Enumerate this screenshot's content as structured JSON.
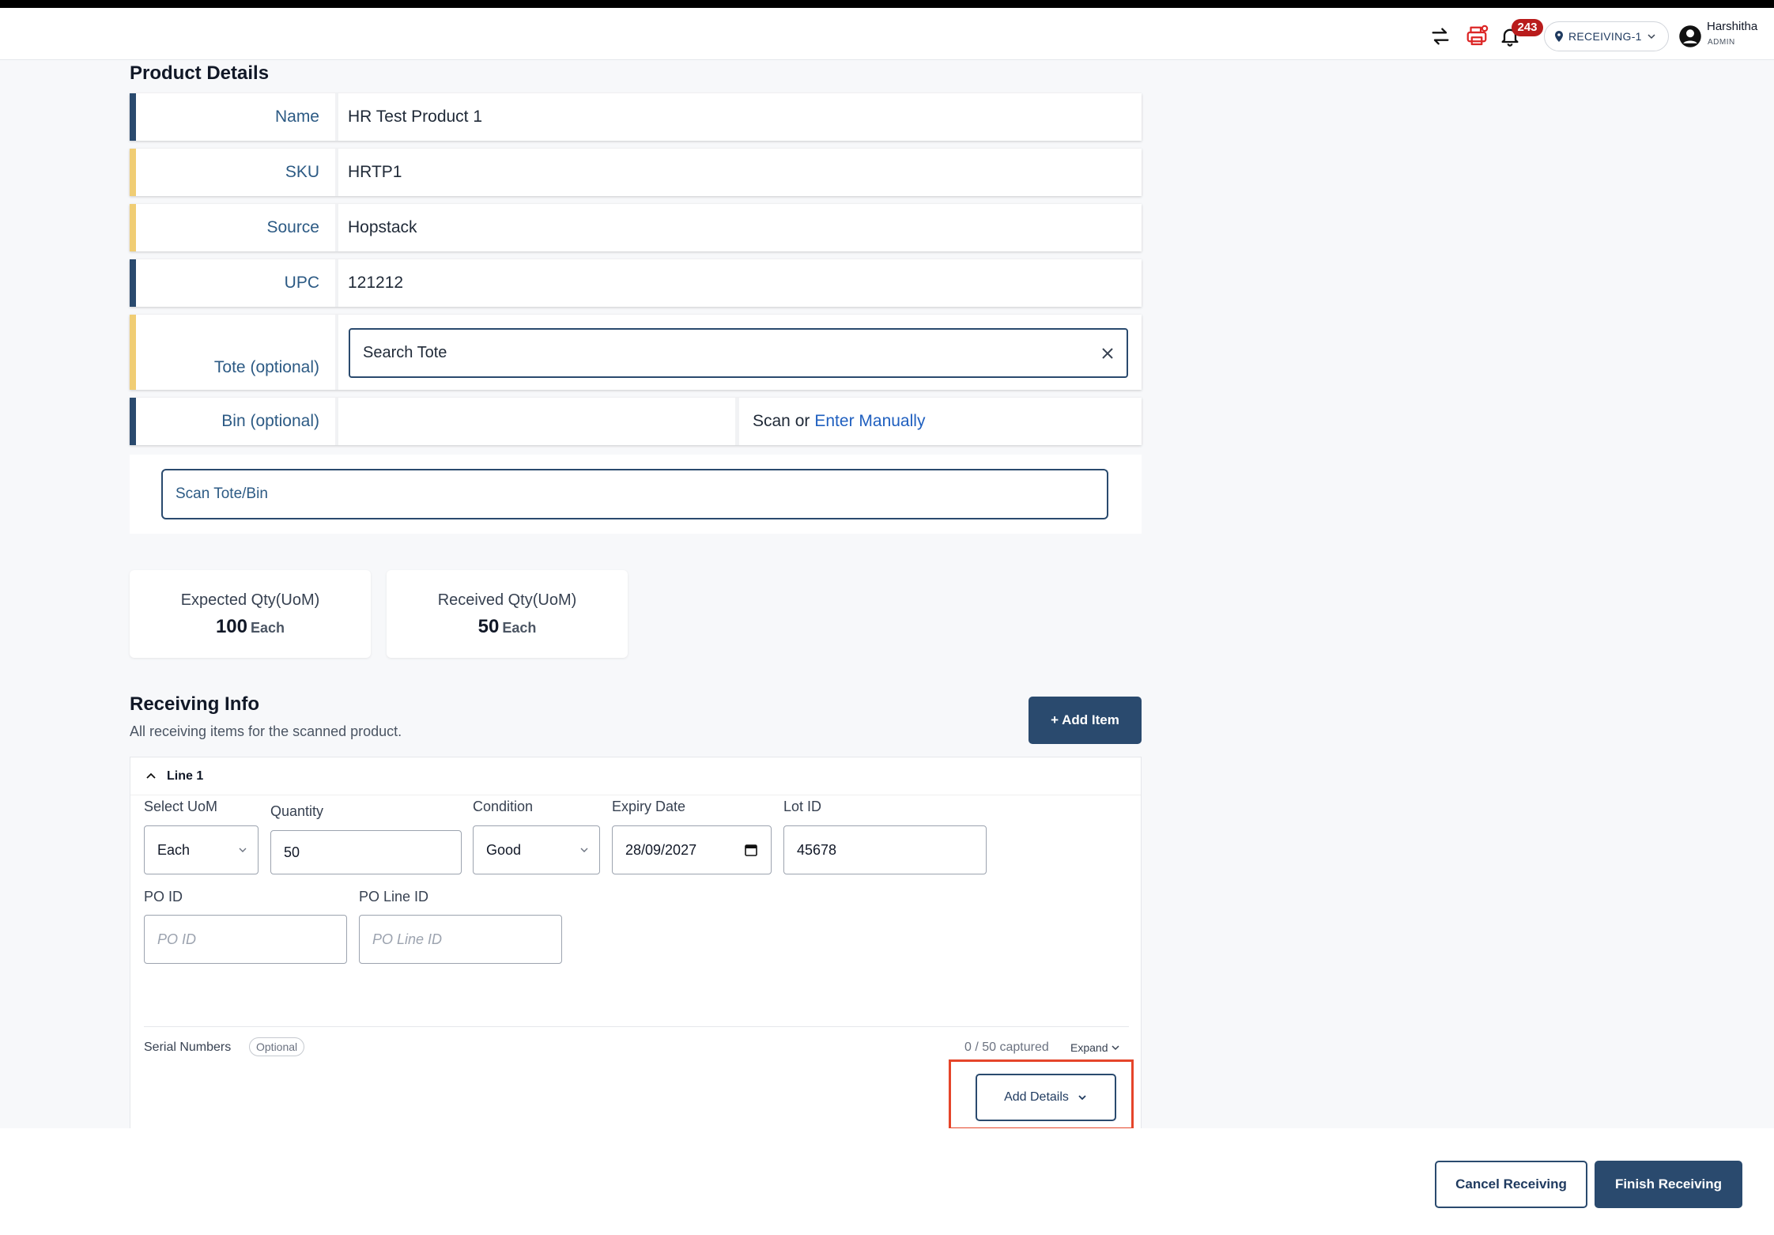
{
  "header": {
    "notifications_count": "243",
    "location": "RECEIVING-1",
    "user_name": "Harshitha",
    "user_role": "ADMIN"
  },
  "product_details": {
    "title": "Product Details",
    "rows": [
      {
        "label": "Name",
        "value": "HR Test Product 1"
      },
      {
        "label": "SKU",
        "value": "HRTP1"
      },
      {
        "label": "Source",
        "value": "Hopstack"
      },
      {
        "label": "UPC",
        "value": "121212"
      }
    ],
    "tote": {
      "label": "Tote (optional)",
      "value": "Search Tote"
    },
    "bin": {
      "label": "Bin (optional)",
      "scan_text": "Scan or",
      "enter_manually": "Enter Manually"
    },
    "scan_placeholder": "Scan Tote/Bin"
  },
  "quantities": {
    "expected": {
      "label": "Expected Qty(UoM)",
      "value": "100",
      "unit": "Each"
    },
    "received": {
      "label": "Received Qty(UoM)",
      "value": "50",
      "unit": "Each"
    }
  },
  "receiving_info": {
    "title": "Receiving Info",
    "subtitle": "All receiving items for the scanned product.",
    "add_item_label": "+ Add Item",
    "line": {
      "title": "Line 1",
      "uom_label": "Select UoM",
      "uom_value": "Each",
      "quantity_label": "Quantity",
      "quantity_value": "50",
      "condition_label": "Condition",
      "condition_value": "Good",
      "expiry_label": "Expiry Date",
      "expiry_value": "28/09/2027",
      "lot_label": "Lot ID",
      "lot_value": "45678",
      "po_label": "PO ID",
      "po_placeholder": "PO ID",
      "po_line_label": "PO Line ID",
      "po_line_placeholder": "PO Line ID",
      "serial_label": "Serial Numbers",
      "serial_optional": "Optional",
      "captured": "0 / 50 captured",
      "expand": "Expand",
      "add_details": "Add Details"
    }
  },
  "footer": {
    "cancel_label": "Cancel Receiving",
    "finish_label": "Finish Receiving"
  },
  "colors": {
    "primary": "#2a4a6e",
    "stripe_yellow": "#f0cd74",
    "badge": "#b91c1c",
    "highlight": "#e5452a",
    "link": "#1f5fbf"
  }
}
